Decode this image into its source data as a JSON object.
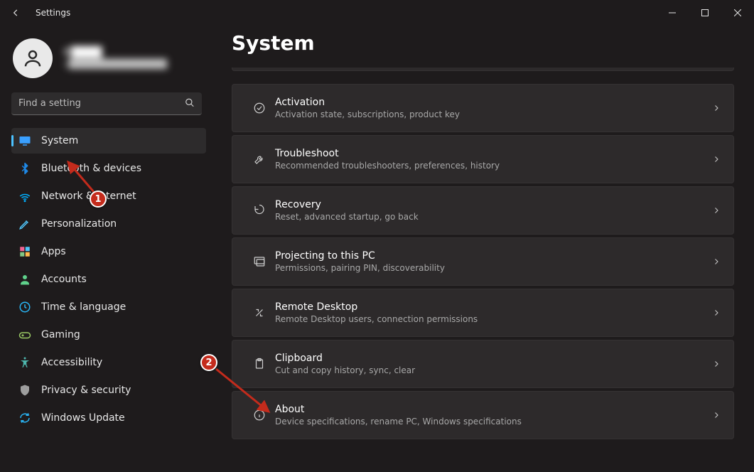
{
  "window": {
    "title": "Settings"
  },
  "user": {
    "name": "C████",
    "email": "c███████████████"
  },
  "search": {
    "placeholder": "Find a setting"
  },
  "nav": [
    {
      "id": "system",
      "label": "System",
      "color": "#3aa0ff",
      "selected": true
    },
    {
      "id": "bluetooth",
      "label": "Bluetooth & devices",
      "color": "#1f88e5"
    },
    {
      "id": "network",
      "label": "Network & internet",
      "color": "#00b0ff"
    },
    {
      "id": "personalization",
      "label": "Personalization",
      "color": "#4fc3f7"
    },
    {
      "id": "apps",
      "label": "Apps",
      "color": "#f06292"
    },
    {
      "id": "accounts",
      "label": "Accounts",
      "color": "#5fd18b"
    },
    {
      "id": "time",
      "label": "Time & language",
      "color": "#29b6f6"
    },
    {
      "id": "gaming",
      "label": "Gaming",
      "color": "#9ccc65"
    },
    {
      "id": "accessibility",
      "label": "Accessibility",
      "color": "#4db6ac"
    },
    {
      "id": "privacy",
      "label": "Privacy & security",
      "color": "#9e9e9e"
    },
    {
      "id": "update",
      "label": "Windows Update",
      "color": "#29b6f6"
    }
  ],
  "page": {
    "title": "System"
  },
  "cards": [
    {
      "id": "activation",
      "title": "Activation",
      "subtitle": "Activation state, subscriptions, product key"
    },
    {
      "id": "troubleshoot",
      "title": "Troubleshoot",
      "subtitle": "Recommended troubleshooters, preferences, history"
    },
    {
      "id": "recovery",
      "title": "Recovery",
      "subtitle": "Reset, advanced startup, go back"
    },
    {
      "id": "projecting",
      "title": "Projecting to this PC",
      "subtitle": "Permissions, pairing PIN, discoverability"
    },
    {
      "id": "remote",
      "title": "Remote Desktop",
      "subtitle": "Remote Desktop users, connection permissions"
    },
    {
      "id": "clipboard",
      "title": "Clipboard",
      "subtitle": "Cut and copy history, sync, clear"
    },
    {
      "id": "about",
      "title": "About",
      "subtitle": "Device specifications, rename PC, Windows specifications"
    }
  ],
  "annotations": {
    "badge1": "1",
    "badge2": "2"
  }
}
